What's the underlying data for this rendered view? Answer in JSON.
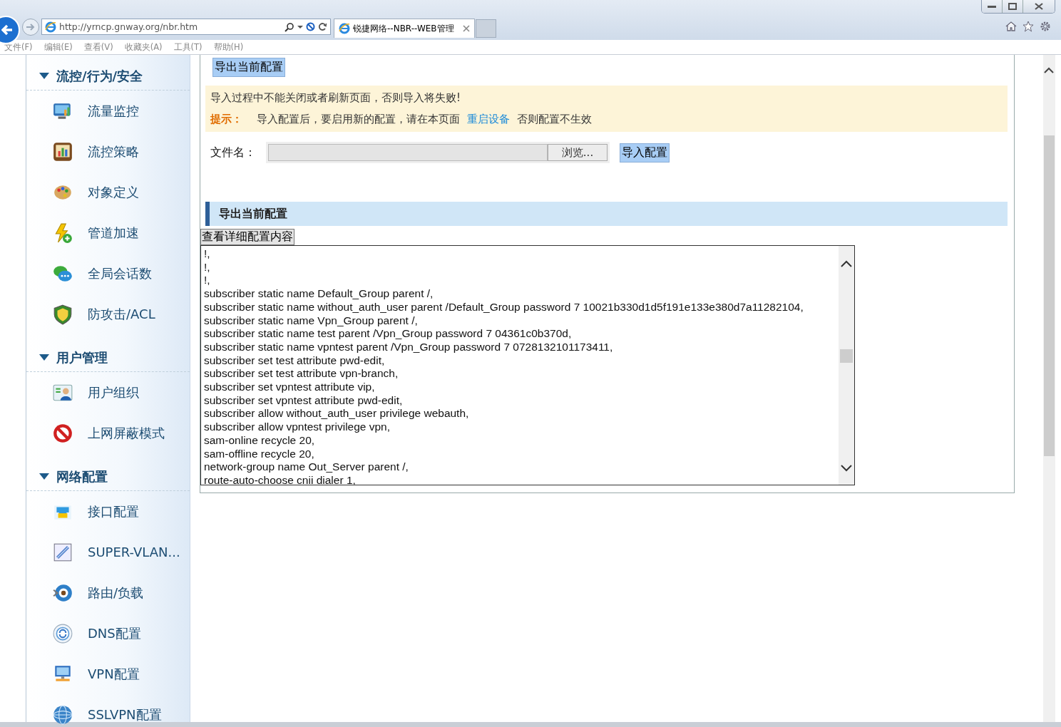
{
  "browser": {
    "address": "http://yrncp.gnway.org/nbr.htm",
    "tabs": [
      {
        "title": "锐捷网络--NBR--WEB管理",
        "selected": true
      }
    ],
    "menu": [
      "文件(F)",
      "编辑(E)",
      "查看(V)",
      "收藏夹(A)",
      "工具(T)",
      "帮助(H)"
    ]
  },
  "sidebar": {
    "groups": [
      {
        "title": "流控/行为/安全",
        "expanded": true,
        "items": [
          {
            "label": "流量监控"
          },
          {
            "label": "流控策略"
          },
          {
            "label": "对象定义"
          },
          {
            "label": "管道加速"
          },
          {
            "label": "全局会话数"
          },
          {
            "label": "防攻击/ACL"
          }
        ]
      },
      {
        "title": "用户管理",
        "expanded": true,
        "items": [
          {
            "label": "用户组织"
          },
          {
            "label": "上网屏蔽模式"
          }
        ]
      },
      {
        "title": "网络配置",
        "expanded": true,
        "items": [
          {
            "label": "接口配置"
          },
          {
            "label": "SUPER-VLAN..."
          },
          {
            "label": "路由/负载"
          },
          {
            "label": "DNS配置"
          },
          {
            "label": "VPN配置"
          },
          {
            "label": "SSLVPN配置"
          }
        ]
      }
    ]
  },
  "content": {
    "export_button": "导出当前配置",
    "notice": {
      "warning": "导入过程中不能关闭或者刷新页面，否则导入将失败!",
      "hint_label": "提示：",
      "hint_text": "导入配置后，要启用新的配置，请在本页面",
      "link": "重启设备",
      "hint_tail": "否则配置不生效"
    },
    "file_row": {
      "label": "文件名：",
      "browse_button": "浏览...",
      "import_button": "导入配置"
    },
    "section_title": "导出当前配置",
    "view_button": "查看详细配置内容",
    "config_lines": [
      "!,",
      "!,",
      "!,",
      "subscriber static name Default_Group parent /,",
      "subscriber static name without_auth_user parent /Default_Group password 7 10021b330d1d5f191e133e380d7a11282104,",
      "subscriber static name Vpn_Group parent /,",
      "subscriber static name test parent /Vpn_Group password 7 04361c0b370d,",
      "subscriber static name vpntest parent /Vpn_Group password 7 0728132101173411,",
      "subscriber set test attribute pwd-edit,",
      "subscriber set test attribute vpn-branch,",
      "subscriber set vpntest attribute vip,",
      "subscriber set vpntest attribute pwd-edit,",
      "subscriber allow without_auth_user privilege webauth,",
      "subscriber allow vpntest privilege vpn,",
      "sam-online recycle 20,",
      "sam-offline recycle 20,",
      "network-group name  Out_Server parent /,",
      "route-auto-choose cnii dialer 1,"
    ]
  }
}
